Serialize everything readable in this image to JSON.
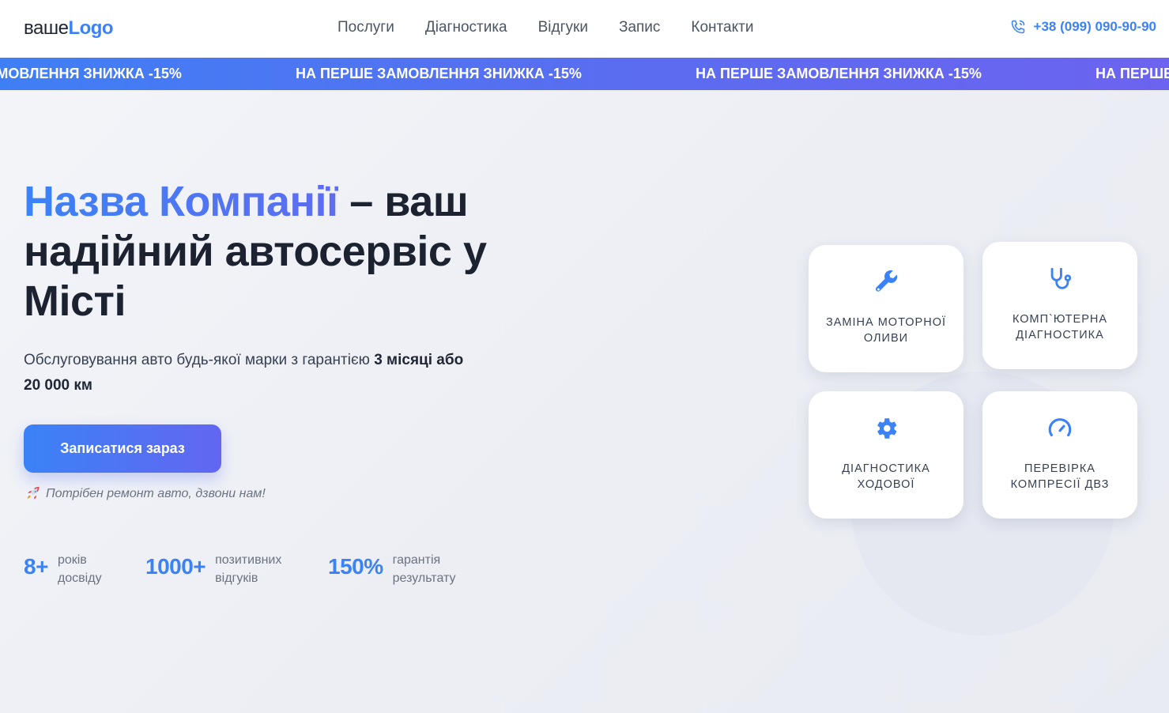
{
  "header": {
    "logo_prefix": "ваше",
    "logo_suffix": "Logo",
    "nav": [
      {
        "label": "Послуги"
      },
      {
        "label": "Діагностика"
      },
      {
        "label": "Відгуки"
      },
      {
        "label": "Запис"
      },
      {
        "label": "Контакти"
      }
    ],
    "phone": "+38 (099) 090-90-90",
    "phone_icon": "phone-icon"
  },
  "ticker": {
    "items": [
      "НА ПЕРШЕ ЗАМОВЛЕННЯ ЗНИЖКА -15%",
      "НА ПЕРШЕ ЗАМОВЛЕННЯ ЗНИЖКА -15%",
      "НА ПЕРШЕ ЗАМОВЛЕННЯ ЗНИЖКА -15%",
      "НА ПЕРШЕ ЗАМОВЛЕННЯ ЗНИЖКА -15%"
    ]
  },
  "hero": {
    "title_brand": "Назва Компанії",
    "title_rest": " – ваш надійний автосервіс у Місті",
    "subtitle_start": "Обслуговування авто будь-якої марки з гарантією ",
    "subtitle_bold": "3 місяці або 20 000 км",
    "cta_label": "Записатися зараз",
    "note": "Потрібен ремонт авто, дзвони нам!",
    "note_icon": "rocket-icon"
  },
  "stats": [
    {
      "value": "8+",
      "label": "років досвіду"
    },
    {
      "value": "1000+",
      "label": "позитивних відгуків"
    },
    {
      "value": "150%",
      "label": "гарантія результату"
    }
  ],
  "cards": [
    {
      "label": "Заміна моторної оливи",
      "icon": "wrench-icon"
    },
    {
      "label": "Комп`ютерна діагностика",
      "icon": "stethoscope-icon"
    },
    {
      "label": "Діагностика ходової",
      "icon": "gear-icon"
    },
    {
      "label": "Перевірка компресії ДВЗ",
      "icon": "gauge-icon"
    }
  ],
  "colors": {
    "accent": "#3b82f6",
    "accent_2": "#6366f1",
    "text_dark": "#1f2533",
    "text_muted": "#6b7280"
  }
}
